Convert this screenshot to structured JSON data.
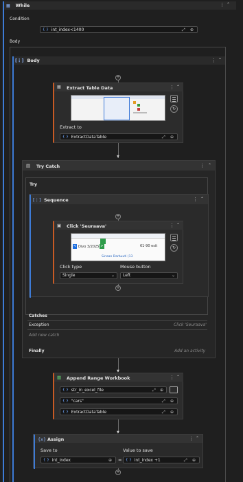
{
  "while": {
    "title": "While",
    "condition_label": "Condition",
    "condition_value": "int_index<1400",
    "body_label": "Body"
  },
  "body": {
    "title": "Body"
  },
  "extract": {
    "title": "Extract Table Data",
    "extract_to_label": "Extract to",
    "extract_to_value": "ExtractDataTable"
  },
  "trycatch": {
    "title": "Try Catch",
    "try_label": "Try",
    "catches_label": "Catches",
    "exception_label": "Exception",
    "exception_hint": "Click 'Seuraava'",
    "add_catch": "Add new catch",
    "finally_label": "Finally",
    "add_activity": "Add an activity"
  },
  "sequence": {
    "title": "Sequence"
  },
  "click": {
    "title": "Click 'Seuraava'",
    "click_type_label": "Click type",
    "click_type_value": "Single",
    "mouse_button_label": "Mouse button",
    "mouse_button_value": "Left",
    "preview_date": "Divo 3/2025",
    "preview_score": "61-90 esit",
    "preview_tail": "Sinaan Darbuuti (13"
  },
  "append": {
    "title": "Append Range Workbook",
    "file_value": "str_in_excel_file",
    "sheet_value": "\"cars\"",
    "table_value": "ExtractDataTable"
  },
  "assign": {
    "title": "Assign",
    "save_to_label": "Save to",
    "value_label": "Value to save",
    "save_to_value": "int_index",
    "equals": "=",
    "value_value": "int_index +1"
  },
  "icons": {
    "collapse": "double-chevron-up-icon",
    "more": "more-vertical-icon",
    "add": "plus-circle-icon",
    "expand": "expand-arrows-icon"
  },
  "colors": {
    "accent": "#c85a24",
    "link": "#6fa8ff",
    "bg": "#1f1f1f"
  }
}
